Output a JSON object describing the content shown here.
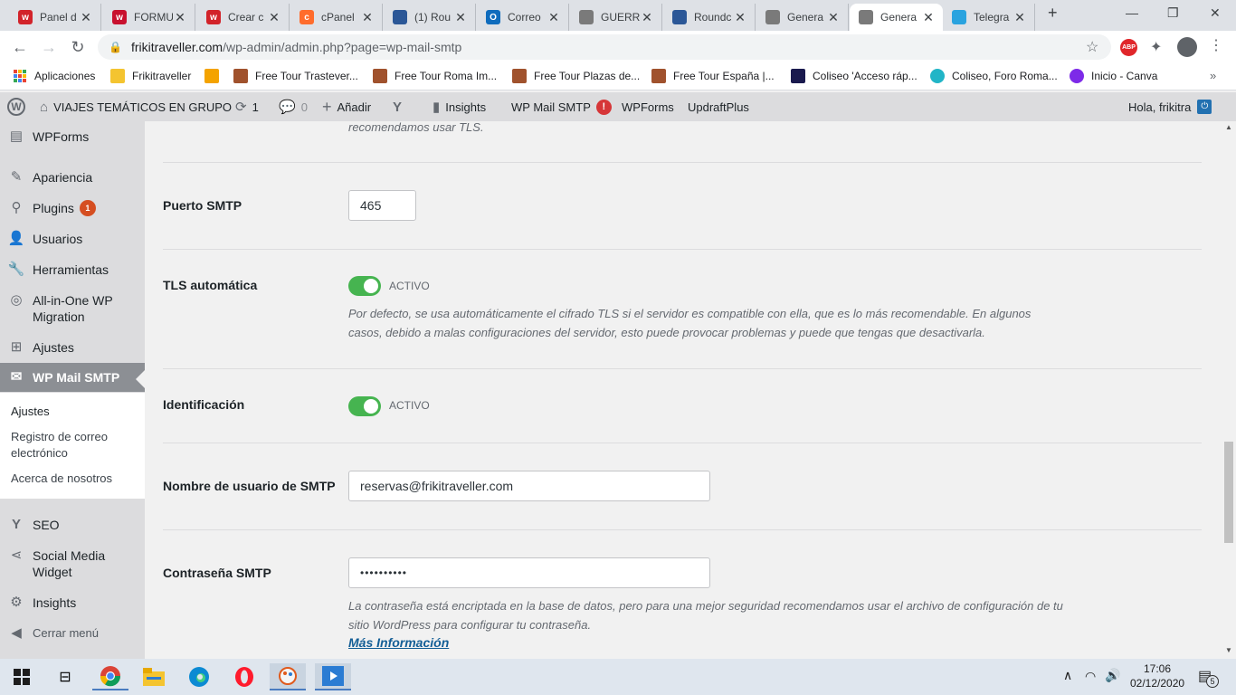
{
  "browser": {
    "tabs": [
      {
        "label": "Panel d",
        "color": "#d2232a",
        "glyph": "w"
      },
      {
        "label": "FORMU",
        "color": "#c8102e",
        "glyph": "w"
      },
      {
        "label": "Crear c",
        "color": "#d2232a",
        "glyph": "w"
      },
      {
        "label": "cPanel",
        "color": "#ff6c2c",
        "glyph": "c"
      },
      {
        "label": "(1) Rou",
        "color": "#2b5797",
        "glyph": ""
      },
      {
        "label": "Correo",
        "color": "#0f6cbd",
        "glyph": "O"
      },
      {
        "label": "GUERR",
        "color": "#7a7a7a",
        "glyph": ""
      },
      {
        "label": "Roundc",
        "color": "#2b5797",
        "glyph": ""
      },
      {
        "label": "Genera",
        "color": "#7a7a7a",
        "glyph": ""
      },
      {
        "label": "Genera",
        "color": "#7a7a7a",
        "glyph": ""
      },
      {
        "label": "Telegra",
        "color": "#2aa3df",
        "glyph": ""
      }
    ],
    "url_host": "frikitraveller.com",
    "url_path": "/wp-admin/admin.php?page=wp-mail-smtp",
    "bookmarks": [
      {
        "label": "Aplicaciones",
        "color": "#ea4335"
      },
      {
        "label": "Frikitraveller",
        "color": "#f4c430"
      },
      {
        "label": "",
        "color": "#f4a300"
      },
      {
        "label": "Free Tour Trastever...",
        "color": "#a0522d"
      },
      {
        "label": "Free Tour Roma Im...",
        "color": "#a0522d"
      },
      {
        "label": "Free Tour Plazas de...",
        "color": "#a0522d"
      },
      {
        "label": "Free Tour España |...",
        "color": "#a0522d"
      },
      {
        "label": "Coliseo 'Acceso ráp...",
        "color": "#1a1a4e"
      },
      {
        "label": "Coliseo, Foro Roma...",
        "color": "#21b5c7"
      },
      {
        "label": "Inicio - Canva",
        "color": "#7d2ae8"
      }
    ]
  },
  "adminbar": {
    "site": "VIAJES TEMÁTICOS EN GRUPO",
    "updates": "1",
    "comments": "0",
    "add": "Añadir",
    "insights": "Insights",
    "wpmail": "WP Mail SMTP",
    "wpmail_alert": "!",
    "wpforms": "WPForms",
    "updraft": "UpdraftPlus",
    "greeting": "Hola, frikitra"
  },
  "sidebar": {
    "items": [
      {
        "label": "WPForms",
        "icon": "forms-icon"
      },
      {
        "label": "Apariencia",
        "icon": "brush-icon"
      },
      {
        "label": "Plugins",
        "icon": "plug-icon",
        "badge": "1"
      },
      {
        "label": "Usuarios",
        "icon": "user-icon"
      },
      {
        "label": "Herramientas",
        "icon": "wrench-icon"
      },
      {
        "label": "All-in-One WP Migration",
        "icon": "migration-icon"
      },
      {
        "label": "Ajustes",
        "icon": "settings-icon"
      },
      {
        "label": "WP Mail SMTP",
        "icon": "mail-icon"
      },
      {
        "label": "SEO",
        "icon": "yoast-icon"
      },
      {
        "label": "Social Media Widget",
        "icon": "share-icon"
      },
      {
        "label": "Insights",
        "icon": "insights-icon"
      },
      {
        "label": "Cerrar menú",
        "icon": "collapse-icon"
      }
    ],
    "submenu": [
      "Ajustes",
      "Registro de correo electrónico",
      "Acerca de nosotros"
    ]
  },
  "form": {
    "top_desc": "recomendamos usar TLS.",
    "port_label": "Puerto SMTP",
    "port_value": "465",
    "tls_label": "TLS automática",
    "tls_state": "ACTIVO",
    "tls_desc": "Por defecto, se usa automáticamente el cifrado TLS si el servidor es compatible con ella, que es lo más recomendable. En algunos casos, debido a malas configuraciones del servidor, esto puede provocar problemas y puede que tengas que desactivarla.",
    "auth_label": "Identificación",
    "auth_state": "ACTIVO",
    "user_label": "Nombre de usuario de SMTP",
    "user_value": "reservas@frikitraveller.com",
    "pass_label": "Contraseña SMTP",
    "pass_value": "••••••••••",
    "pass_desc": "La contraseña está encriptada en la base de datos, pero para una mejor seguridad recomendamos usar el archivo de configuración de tu sitio WordPress para configurar tu contraseña.",
    "more_info": "Más Información"
  },
  "taskbar": {
    "time": "17:06",
    "date": "02/12/2020",
    "notifications": "5"
  }
}
